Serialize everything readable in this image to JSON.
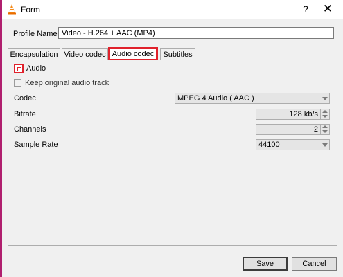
{
  "window": {
    "title": "Form",
    "help": "?",
    "close": "✕"
  },
  "profile": {
    "label": "Profile Name",
    "value": "Video - H.264 + AAC (MP4)"
  },
  "tabs": [
    {
      "label": "Encapsulation"
    },
    {
      "label": "Video codec"
    },
    {
      "label": "Audio codec"
    },
    {
      "label": "Subtitles"
    }
  ],
  "audio": {
    "enable_label": "Audio",
    "keep_label": "Keep original audio track",
    "codec_label": "Codec",
    "codec_value": "MPEG 4 Audio ( AAC )",
    "bitrate_label": "Bitrate",
    "bitrate_value": "128 kb/s",
    "channels_label": "Channels",
    "channels_value": "2",
    "samplerate_label": "Sample Rate",
    "samplerate_value": "44100"
  },
  "buttons": {
    "save": "Save",
    "cancel": "Cancel"
  },
  "colors": {
    "highlight": "#e0212b",
    "accent_bar": "#b01f6e"
  }
}
